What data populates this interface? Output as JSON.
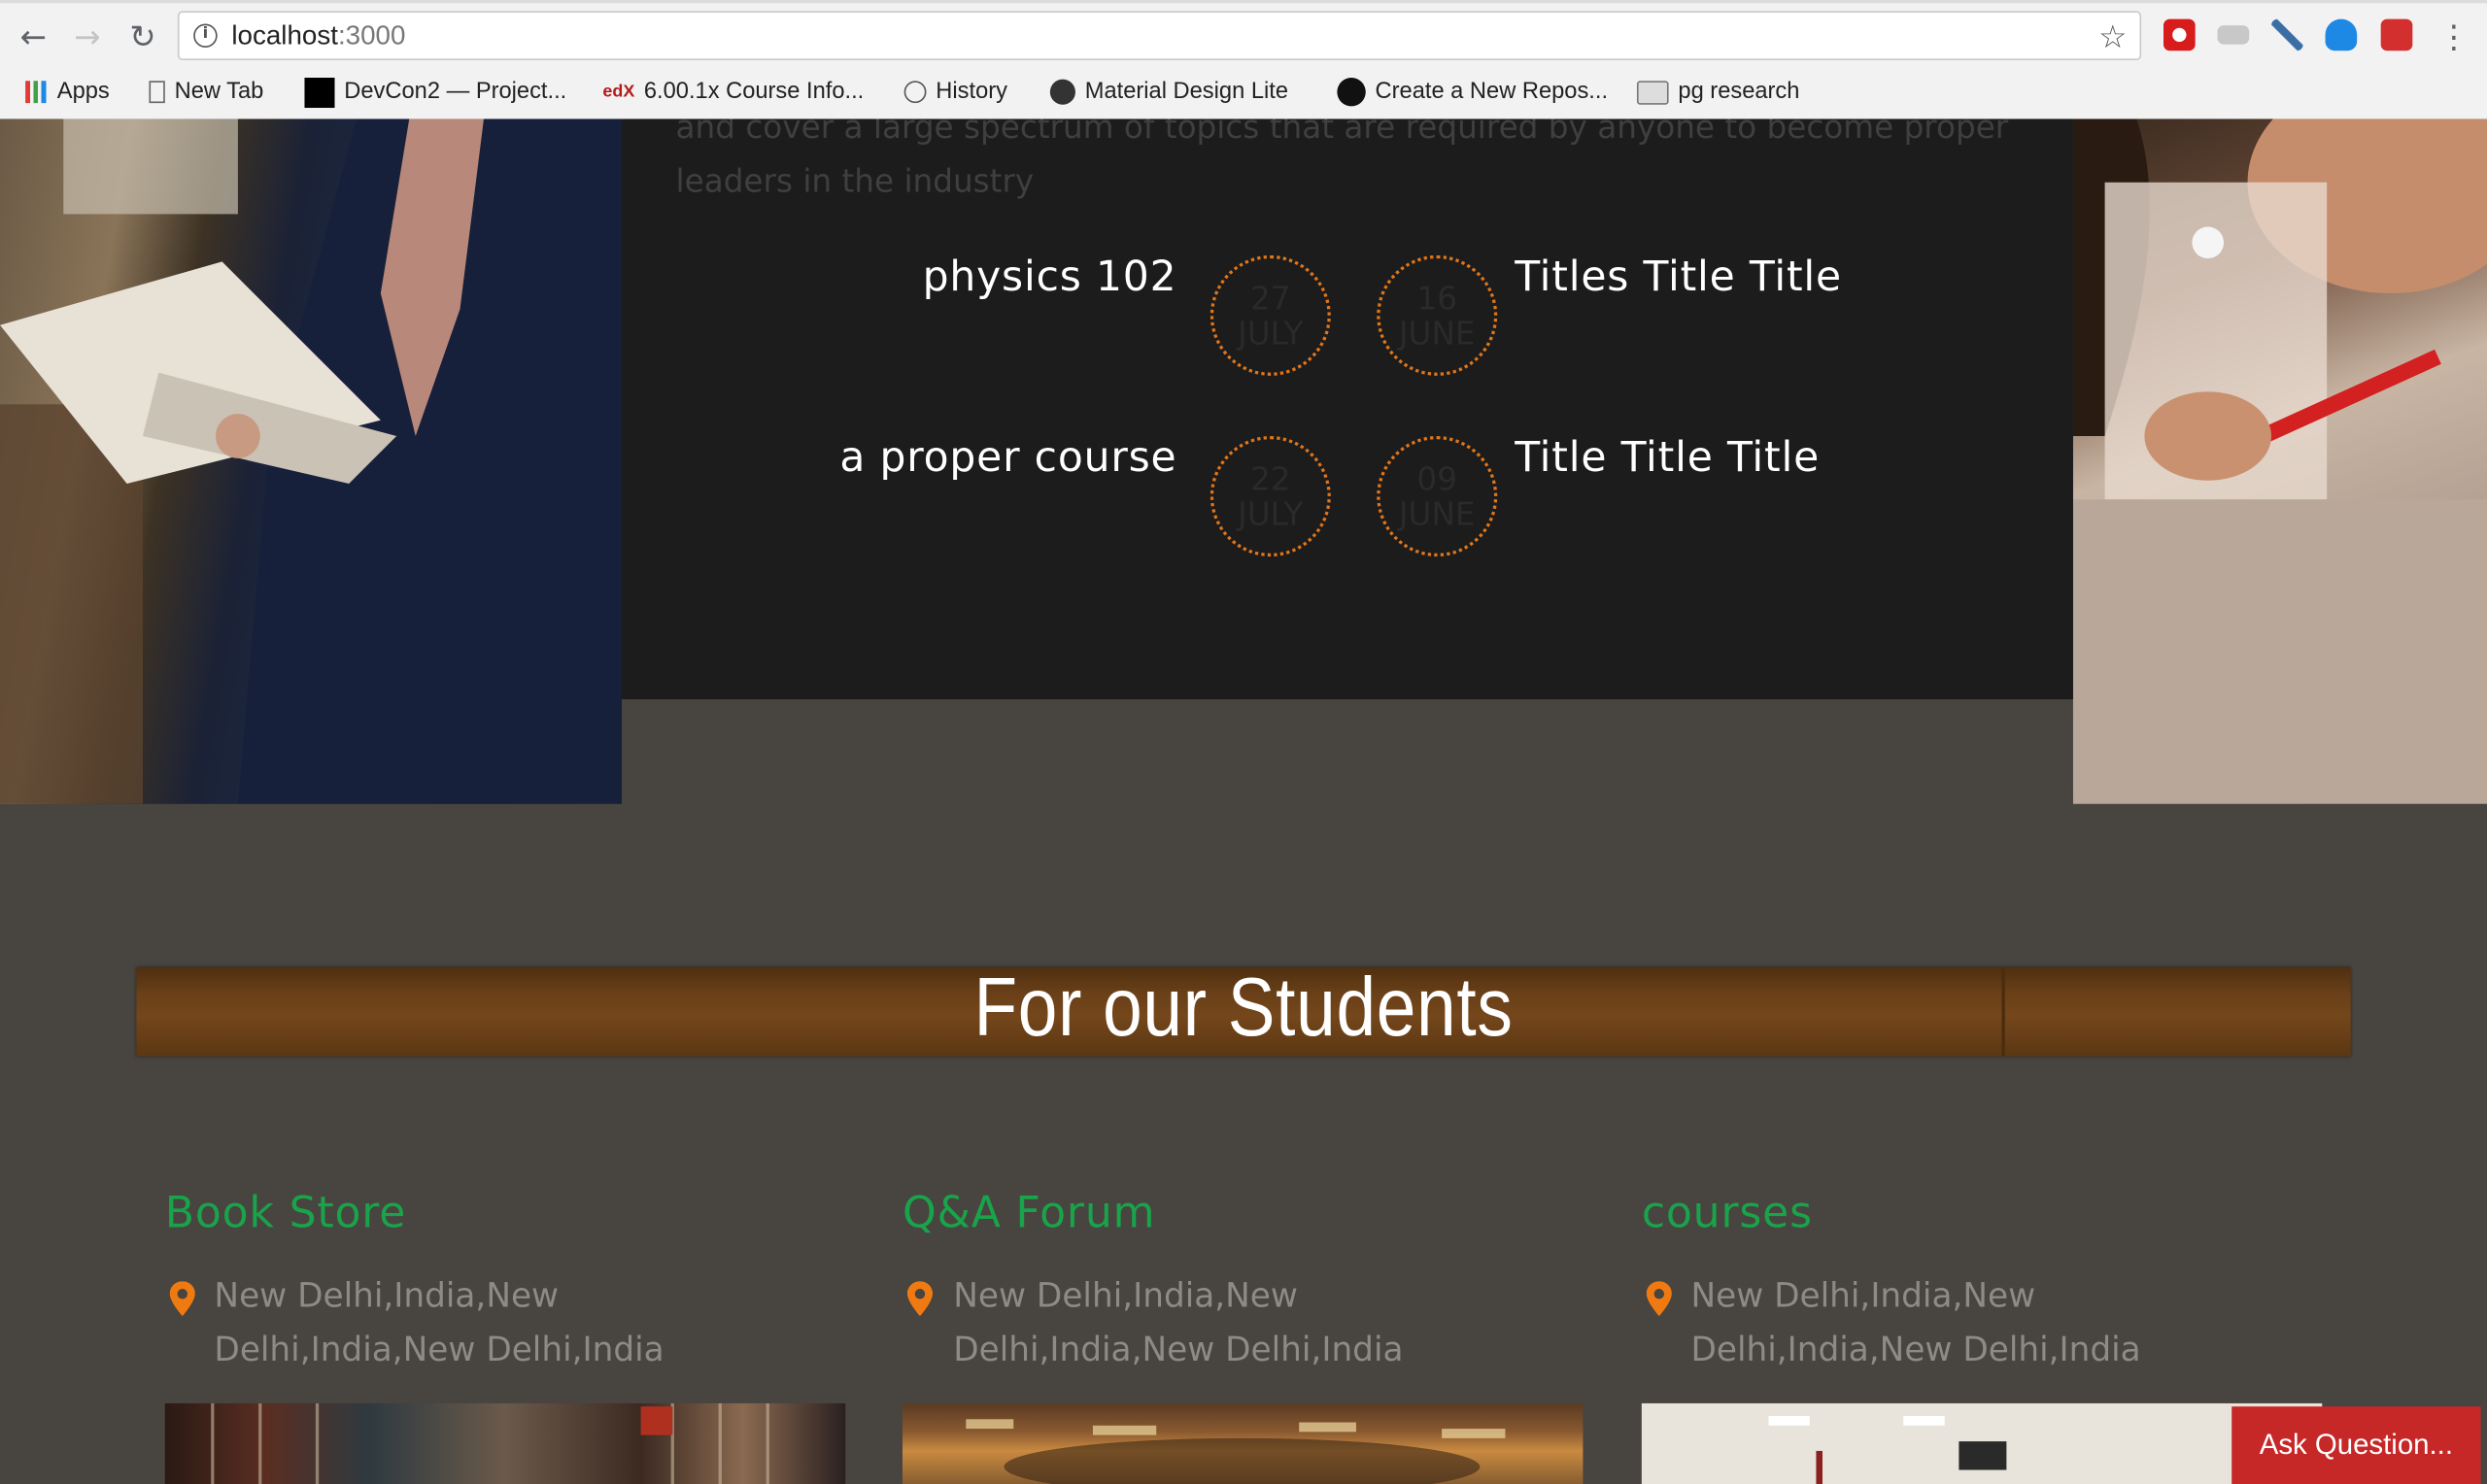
{
  "browser": {
    "url_host": "localhost",
    "url_port": ":3000",
    "bookmarks": [
      {
        "label": "Apps",
        "icon": "apps-grid-icon"
      },
      {
        "label": "New Tab",
        "icon": "page-icon"
      },
      {
        "label": "DevCon2 — Project...",
        "icon": "black-square-icon"
      },
      {
        "label": "6.00.1x Course Info...",
        "icon": "edx-icon"
      },
      {
        "label": "History",
        "icon": "history-icon"
      },
      {
        "label": "Material Design Lite",
        "icon": "mdl-icon"
      },
      {
        "label": "Create a New Repos...",
        "icon": "github-icon"
      },
      {
        "label": "pg research",
        "icon": "folder-icon"
      }
    ]
  },
  "intro": {
    "text": "and cover a large spectrum of topics that are required by anyone to become proper leaders in the industry"
  },
  "events": [
    {
      "title": "physics 102",
      "day": "27",
      "month": "JULY"
    },
    {
      "title": "Titles Title Title",
      "day": "16",
      "month": "JUNE"
    },
    {
      "title": "a proper course",
      "day": "22",
      "month": "JULY"
    },
    {
      "title": "Title Title Title",
      "day": "09",
      "month": "JUNE"
    }
  ],
  "students": {
    "heading": "For our Students",
    "columns": [
      {
        "title": "Book Store",
        "address": "New Delhi,India,New Delhi,India,New Delhi,India"
      },
      {
        "title": "Q&A Forum",
        "address": "New Delhi,India,New Delhi,India,New Delhi,India"
      },
      {
        "title": "courses",
        "address": "New Delhi,India,New Delhi,India,New Delhi,India"
      }
    ]
  },
  "ask_button": "Ask Question...",
  "colors": {
    "accent_orange": "#e0761a",
    "green_title": "#19a34a",
    "ask_red": "#c62828",
    "page_bg": "#48443f",
    "panel_bg": "#1c1c1c"
  }
}
